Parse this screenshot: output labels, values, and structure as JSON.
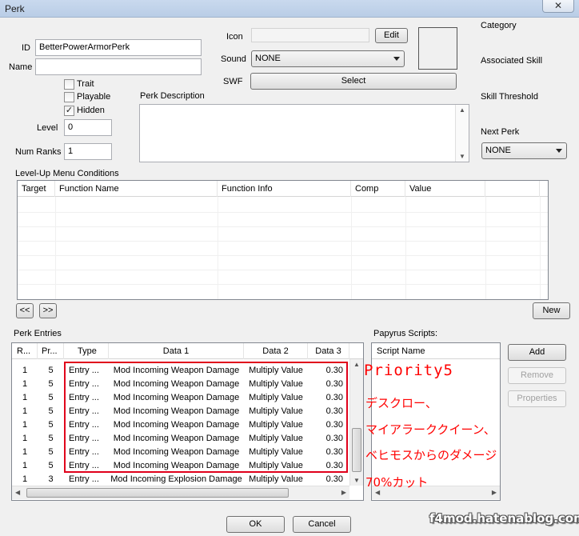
{
  "window": {
    "title": "Perk",
    "close_glyph": "✕"
  },
  "form": {
    "id_label": "ID",
    "id_value": "BetterPowerArmorPerk",
    "name_label": "Name",
    "name_value": "",
    "trait_label": "Trait",
    "trait_checked": false,
    "playable_label": "Playable",
    "playable_checked": false,
    "hidden_label": "Hidden",
    "hidden_checked": true,
    "level_label": "Level",
    "level_value": "0",
    "num_ranks_label": "Num Ranks",
    "num_ranks_value": "1",
    "icon_label": "Icon",
    "icon_value": "",
    "edit_button": "Edit",
    "sound_label": "Sound",
    "sound_value": "NONE",
    "swf_label": "SWF",
    "select_button": "Select",
    "perk_description_label": "Perk Description",
    "perk_description_value": "",
    "category_label": "Category",
    "associated_skill_label": "Associated Skill",
    "skill_threshold_label": "Skill Threshold",
    "next_perk_label": "Next Perk",
    "next_perk_value": "NONE"
  },
  "conditions": {
    "label": "Level-Up Menu Conditions",
    "columns": [
      "Target",
      "Function Name",
      "Function Info",
      "Comp",
      "Value"
    ],
    "prev_button": "<<",
    "next_button": ">>",
    "new_button": "New"
  },
  "perk_entries": {
    "label": "Perk Entries",
    "columns": [
      "R...",
      "Pr...",
      "Type",
      "Data 1",
      "Data 2",
      "Data 3"
    ],
    "rows": [
      [
        "1",
        "5",
        "Entry ...",
        "Mod Incoming Weapon Damage",
        "Multiply Value",
        "0.30"
      ],
      [
        "1",
        "5",
        "Entry ...",
        "Mod Incoming Weapon Damage",
        "Multiply Value",
        "0.30"
      ],
      [
        "1",
        "5",
        "Entry ...",
        "Mod Incoming Weapon Damage",
        "Multiply Value",
        "0.30"
      ],
      [
        "1",
        "5",
        "Entry ...",
        "Mod Incoming Weapon Damage",
        "Multiply Value",
        "0.30"
      ],
      [
        "1",
        "5",
        "Entry ...",
        "Mod Incoming Weapon Damage",
        "Multiply Value",
        "0.30"
      ],
      [
        "1",
        "5",
        "Entry ...",
        "Mod Incoming Weapon Damage",
        "Multiply Value",
        "0.30"
      ],
      [
        "1",
        "5",
        "Entry ...",
        "Mod Incoming Weapon Damage",
        "Multiply Value",
        "0.30"
      ],
      [
        "1",
        "5",
        "Entry ...",
        "Mod Incoming Weapon Damage",
        "Multiply Value",
        "0.30"
      ],
      [
        "1",
        "3",
        "Entry ...",
        "Mod Incoming Explosion Damage",
        "Multiply Value",
        "0.30"
      ]
    ]
  },
  "papyrus": {
    "label": "Papyrus Scripts:",
    "column": "Script Name",
    "add_button": "Add",
    "remove_button": "Remove",
    "properties_button": "Properties"
  },
  "annotations": {
    "line1": "Priority5",
    "line2": "デスクロー、",
    "line3": "マイアラーククイーン、",
    "line4": "ベヒモスからのダメージ",
    "line5": "70%カット",
    "color": "#ff0000"
  },
  "watermark": "f4mod.hatenablog.com",
  "footer": {
    "ok_button": "OK",
    "cancel_button": "Cancel"
  }
}
